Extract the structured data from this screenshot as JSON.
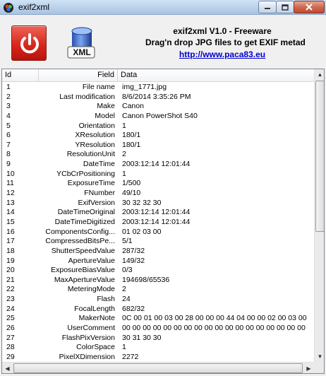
{
  "window": {
    "title": "exif2xml"
  },
  "header": {
    "title": "exif2xml V1.0 - Freeware",
    "subtitle": "Drag'n drop JPG files to get EXIF metad",
    "link": "http://www.paca83.eu",
    "xml_button_label": "XML"
  },
  "table": {
    "columns": {
      "id": "Id",
      "field": "Field",
      "data": "Data"
    },
    "rows": [
      {
        "id": "1",
        "field": "File name",
        "data": "img_1771.jpg"
      },
      {
        "id": "2",
        "field": "Last modification",
        "data": "8/6/2014 3:35:26 PM"
      },
      {
        "id": "3",
        "field": "Make",
        "data": "Canon"
      },
      {
        "id": "4",
        "field": "Model",
        "data": "Canon PowerShot S40"
      },
      {
        "id": "5",
        "field": "Orientation",
        "data": "1"
      },
      {
        "id": "6",
        "field": "XResolution",
        "data": "180/1"
      },
      {
        "id": "7",
        "field": "YResolution",
        "data": "180/1"
      },
      {
        "id": "8",
        "field": "ResolutionUnit",
        "data": "2"
      },
      {
        "id": "9",
        "field": "DateTime",
        "data": "2003:12:14 12:01:44"
      },
      {
        "id": "10",
        "field": "YCbCrPositioning",
        "data": "1"
      },
      {
        "id": "11",
        "field": "ExposureTime",
        "data": "1/500"
      },
      {
        "id": "12",
        "field": "FNumber",
        "data": "49/10"
      },
      {
        "id": "13",
        "field": "ExifVersion",
        "data": "30 32 32 30"
      },
      {
        "id": "14",
        "field": "DateTimeOriginal",
        "data": "2003:12:14 12:01:44"
      },
      {
        "id": "15",
        "field": "DateTimeDigitized",
        "data": "2003:12:14 12:01:44"
      },
      {
        "id": "16",
        "field": "ComponentsConfig...",
        "data": "01 02 03 00"
      },
      {
        "id": "17",
        "field": "CompressedBitsPe...",
        "data": "5/1"
      },
      {
        "id": "18",
        "field": "ShutterSpeedValue",
        "data": "287/32"
      },
      {
        "id": "19",
        "field": "ApertureValue",
        "data": "149/32"
      },
      {
        "id": "20",
        "field": "ExposureBiasValue",
        "data": "0/3"
      },
      {
        "id": "21",
        "field": "MaxApertureValue",
        "data": "194698/65536"
      },
      {
        "id": "22",
        "field": "MeteringMode",
        "data": "2"
      },
      {
        "id": "23",
        "field": "Flash",
        "data": "24"
      },
      {
        "id": "24",
        "field": "FocalLength",
        "data": "682/32"
      },
      {
        "id": "25",
        "field": "MakerNote",
        "data": "0C 00 01 00 03 00 28 00 00 00 44 04 00 00 02 00 03 00"
      },
      {
        "id": "26",
        "field": "UserComment",
        "data": "00 00 00 00 00 00 00 00 00 00 00 00 00 00 00 00 00 00"
      },
      {
        "id": "27",
        "field": "FlashPixVersion",
        "data": "30 31 30 30"
      },
      {
        "id": "28",
        "field": "ColorSpace",
        "data": "1"
      },
      {
        "id": "29",
        "field": "PixelXDimension",
        "data": "2272"
      }
    ]
  }
}
